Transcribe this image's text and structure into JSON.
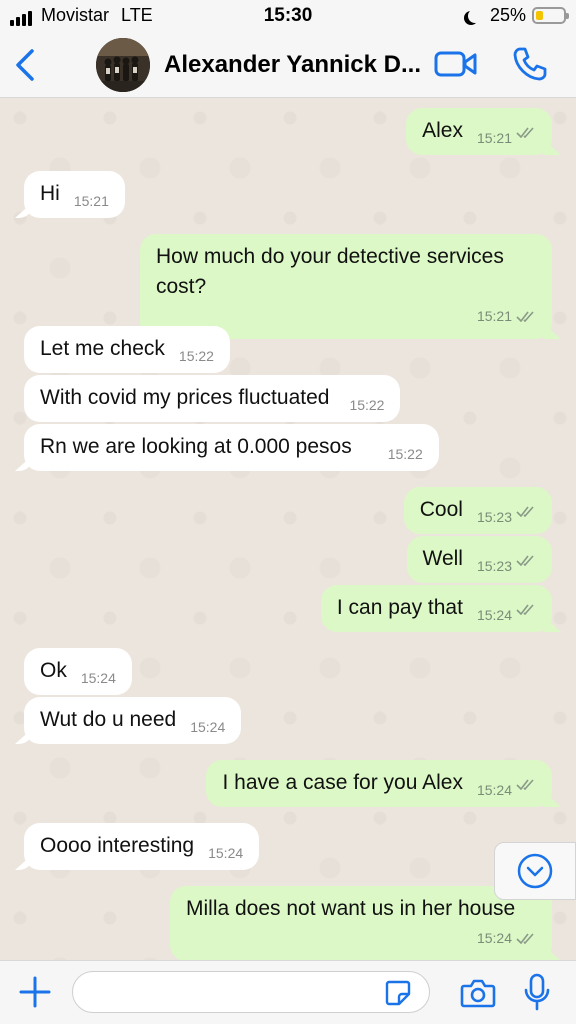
{
  "status_bar": {
    "carrier": "Movistar",
    "network": "LTE",
    "time": "15:30",
    "battery_percent": "25%",
    "battery_level": 0.25
  },
  "header": {
    "contact_name": "Alexander Yannick D..."
  },
  "colors": {
    "accent": "#1a73e8",
    "incoming_bubble": "#ffffff",
    "outgoing_bubble": "#dcf8c6",
    "chat_bg": "#ece5dd"
  },
  "messages": [
    {
      "dir": "out",
      "text": "Alex",
      "time": "15:21"
    },
    {
      "dir": "in",
      "text": "Hi",
      "time": "15:21"
    },
    {
      "dir": "out",
      "text": "How much do your detective services cost?",
      "time": "15:21"
    },
    {
      "dir": "in",
      "text": "Let me check",
      "time": "15:22"
    },
    {
      "dir": "in",
      "text": "With covid my prices fluctuated",
      "time": "15:22"
    },
    {
      "dir": "in",
      "text": "Rn we are looking at 0.000 pesos",
      "time": "15:22"
    },
    {
      "dir": "out",
      "text": "Cool",
      "time": "15:23"
    },
    {
      "dir": "out",
      "text": "Well",
      "time": "15:23"
    },
    {
      "dir": "out",
      "text": "I can pay that",
      "time": "15:24"
    },
    {
      "dir": "in",
      "text": "Ok",
      "time": "15:24"
    },
    {
      "dir": "in",
      "text": "Wut do u need",
      "time": "15:24"
    },
    {
      "dir": "out",
      "text": "I have a case for you Alex",
      "time": "15:24"
    },
    {
      "dir": "in",
      "text": "Oooo interesting",
      "time": "15:24"
    },
    {
      "dir": "out",
      "text": "Milla does not want us in her house",
      "time": "15:24"
    }
  ],
  "composer": {
    "value": "",
    "placeholder": ""
  }
}
